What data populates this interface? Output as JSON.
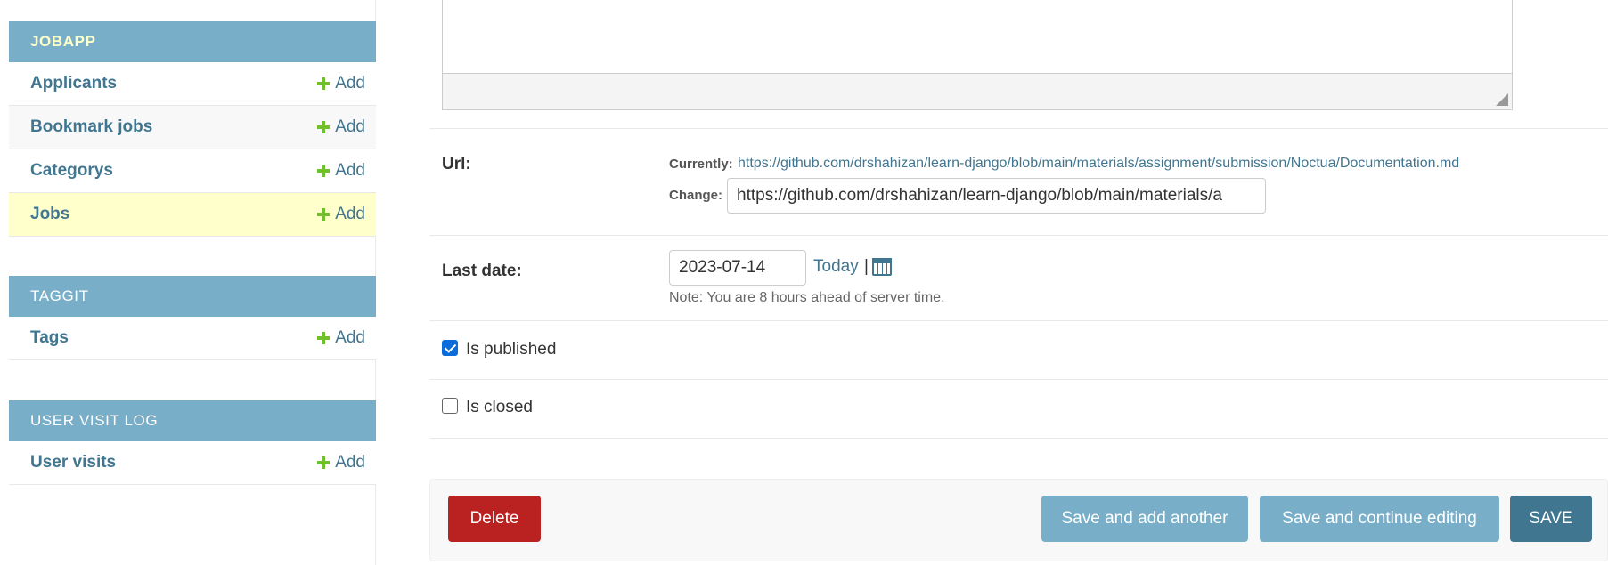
{
  "sidebar": {
    "modules": [
      {
        "name": "JOBAPP",
        "models": [
          {
            "label": "Applicants",
            "add": "Add"
          },
          {
            "label": "Bookmark jobs",
            "add": "Add"
          },
          {
            "label": "Categorys",
            "add": "Add"
          },
          {
            "label": "Jobs",
            "add": "Add"
          }
        ]
      },
      {
        "name": "TAGGIT",
        "models": [
          {
            "label": "Tags",
            "add": "Add"
          }
        ]
      },
      {
        "name": "USER VISIT LOG",
        "models": [
          {
            "label": "User visits",
            "add": "Add"
          }
        ]
      }
    ]
  },
  "form": {
    "url": {
      "label": "Url:",
      "currently_label": "Currently:",
      "currently_value": "https://github.com/drshahizan/learn-django/blob/main/materials/assignment/submission/Noctua/Documentation.md",
      "change_label": "Change:",
      "change_value": "https://github.com/drshahizan/learn-django/blob/main/materials/a"
    },
    "last_date": {
      "label": "Last date:",
      "value": "2023-07-14",
      "today": "Today",
      "separator": "|",
      "note": "Note: You are 8 hours ahead of server time."
    },
    "is_published": {
      "label": "Is published",
      "checked": true
    },
    "is_closed": {
      "label": "Is closed",
      "checked": false
    }
  },
  "actions": {
    "delete": "Delete",
    "save_add_another": "Save and add another",
    "save_continue": "Save and continue editing",
    "save": "SAVE"
  },
  "colors": {
    "module_header": "#79aec8",
    "link": "#417690",
    "add_icon": "#70bf2b",
    "current_row": "#ffffcc",
    "delete": "#ba2121",
    "save": "#417690"
  }
}
